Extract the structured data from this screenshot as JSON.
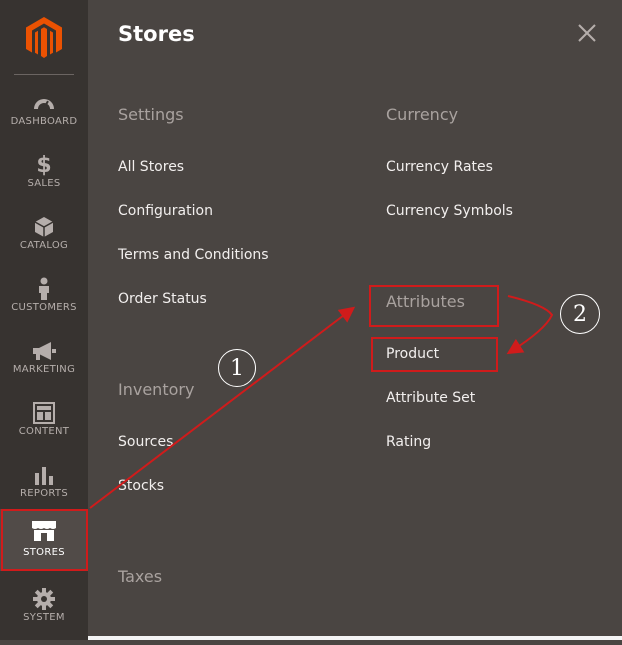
{
  "sidebar": {
    "logo_icon": "magento-logo-icon",
    "items": [
      {
        "label": "DASHBOARD",
        "icon": "speedometer-icon"
      },
      {
        "label": "SALES",
        "icon": "dollar-icon"
      },
      {
        "label": "CATALOG",
        "icon": "cube-icon"
      },
      {
        "label": "CUSTOMERS",
        "icon": "person-icon"
      },
      {
        "label": "MARKETING",
        "icon": "megaphone-icon"
      },
      {
        "label": "CONTENT",
        "icon": "layout-icon"
      },
      {
        "label": "REPORTS",
        "icon": "bar-chart-icon"
      },
      {
        "label": "STORES",
        "icon": "storefront-icon",
        "active": true
      },
      {
        "label": "SYSTEM",
        "icon": "gear-icon"
      }
    ]
  },
  "panel": {
    "title": "Stores",
    "close_icon": "close-icon",
    "settings": {
      "title": "Settings",
      "links": [
        "All Stores",
        "Configuration",
        "Terms and Conditions",
        "Order Status"
      ]
    },
    "inventory": {
      "title": "Inventory",
      "links": [
        "Sources",
        "Stocks"
      ]
    },
    "taxes": {
      "title": "Taxes"
    },
    "currency": {
      "title": "Currency",
      "links": [
        "Currency Rates",
        "Currency Symbols"
      ]
    },
    "attributes": {
      "title": "Attributes",
      "links": [
        "Product",
        "Attribute Set",
        "Rating"
      ]
    }
  },
  "annotations": {
    "step1": "1",
    "step2": "2",
    "highlight_color": "#d01b1b"
  },
  "colors": {
    "sidebar_bg": "#373330",
    "panel_bg": "#4a4542",
    "logo_orange": "#eb5202"
  }
}
